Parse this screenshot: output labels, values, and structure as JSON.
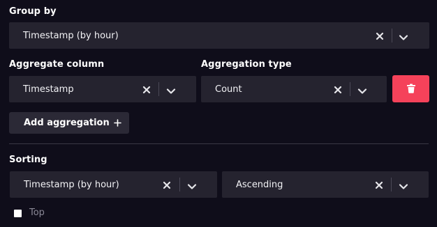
{
  "group_by": {
    "label": "Group by",
    "value": "Timestamp (by hour)"
  },
  "aggregate_column": {
    "label": "Aggregate column",
    "value": "Timestamp"
  },
  "aggregation_type": {
    "label": "Aggregation type",
    "value": "Count"
  },
  "add_aggregation": {
    "label": "Add aggregation"
  },
  "sorting": {
    "label": "Sorting",
    "column_value": "Timestamp (by hour)",
    "direction_value": "Ascending"
  },
  "top": {
    "label": "Top"
  },
  "colors": {
    "background": "#0f0d1a",
    "field": "#25232f",
    "delete_button": "#f5425a",
    "muted_text": "#8a8896"
  },
  "icons": [
    "clear-icon",
    "chevron-down-icon",
    "trash-icon",
    "plus-icon"
  ]
}
